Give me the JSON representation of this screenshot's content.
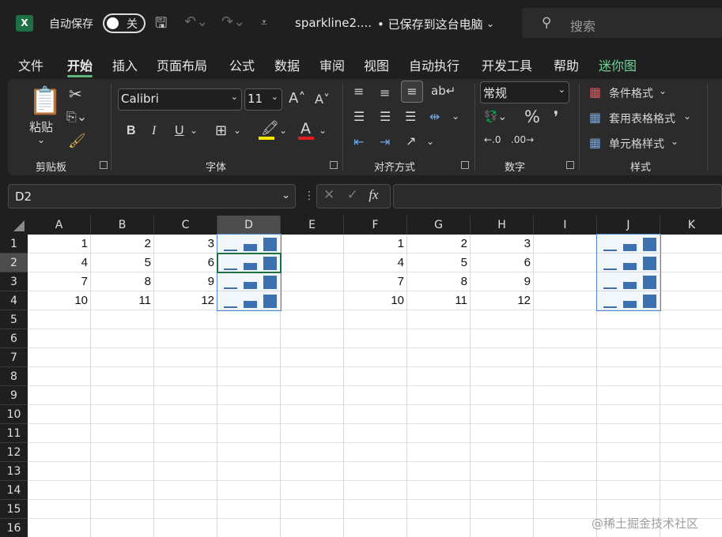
{
  "titlebar": {
    "app_icon": "excel-icon",
    "autosave_label": "自动保存",
    "autosave_state": "关",
    "filename": "sparkline2....",
    "save_status": "• 已保存到这台电脑",
    "search_placeholder": "搜索"
  },
  "menu": [
    "文件",
    "开始",
    "插入",
    "页面布局",
    "公式",
    "数据",
    "审阅",
    "视图",
    "自动执行",
    "开发工具",
    "帮助",
    "迷你图"
  ],
  "ribbon": {
    "clipboard": {
      "paste_label": "粘贴",
      "group_label": "剪贴板"
    },
    "font": {
      "font_name": "Calibri",
      "font_size": "11",
      "group_label": "字体",
      "bold": "B",
      "italic": "I",
      "underline": "U"
    },
    "alignment": {
      "group_label": "对齐方式"
    },
    "number": {
      "format": "常规",
      "percent": "%",
      "group_label": "数字"
    },
    "styles": {
      "conditional": "条件格式",
      "table": "套用表格格式",
      "cell": "单元格样式",
      "group_label": "样式"
    }
  },
  "formula_bar": {
    "name_box": "D2",
    "fx": "fx",
    "formula": ""
  },
  "columns": [
    "A",
    "B",
    "C",
    "D",
    "E",
    "F",
    "G",
    "H",
    "I",
    "J",
    "K"
  ],
  "rows": [
    "1",
    "2",
    "3",
    "4",
    "5",
    "6",
    "7",
    "8",
    "9",
    "10",
    "11",
    "12",
    "13",
    "14",
    "15",
    "16"
  ],
  "cells": {
    "A": [
      "1",
      "4",
      "7",
      "10"
    ],
    "B": [
      "2",
      "5",
      "8",
      "11"
    ],
    "C": [
      "3",
      "6",
      "9",
      "12"
    ],
    "F": [
      "1",
      "4",
      "7",
      "10"
    ],
    "G": [
      "2",
      "5",
      "8",
      "11"
    ],
    "H": [
      "3",
      "6",
      "9",
      "12"
    ]
  },
  "sparklines": {
    "type": "column",
    "color": "#3d6eac",
    "columns": [
      "D",
      "J"
    ],
    "rows": 4
  },
  "selected_cell": "D2",
  "accent": "#1d7044",
  "watermark": "@稀土掘金技术社区"
}
